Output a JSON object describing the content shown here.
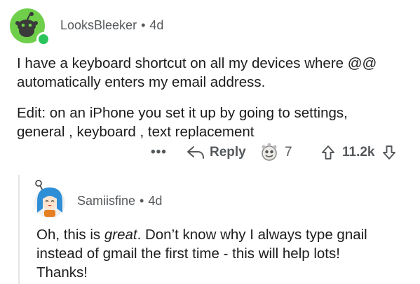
{
  "comment": {
    "author": "LooksBleeker",
    "age": "4d",
    "separator": "•",
    "paragraph1": [
      "I have a keyboard shortcut on all my devices where @@",
      "automatically enters my email address."
    ],
    "paragraph2": [
      "Edit: on an iPhone you set it up by going to settings,",
      "general , keyboard , text replacement"
    ],
    "actions": {
      "more": "•••",
      "reply_label": "Reply",
      "award_count": "7",
      "vote_count": "11.2k"
    }
  },
  "reply": {
    "author": "Samiisfine",
    "age": "4d",
    "separator": "•",
    "text_part1": "Oh, this is ",
    "text_emphasis": "great",
    "text_part2": ". Don’t know why I always type gnail",
    "line2": "instead of gmail the first time - this will help lots!",
    "line3": "Thanks!"
  },
  "colors": {
    "accent_green": "#6fcf4b",
    "online": "#2bc45b",
    "meta_gray": "#55595c"
  },
  "icons": [
    "snoo-avatar-icon",
    "online-status-icon",
    "reply-arrow-icon",
    "award-icon",
    "upvote-icon",
    "downvote-icon",
    "avatar-girl-icon"
  ]
}
